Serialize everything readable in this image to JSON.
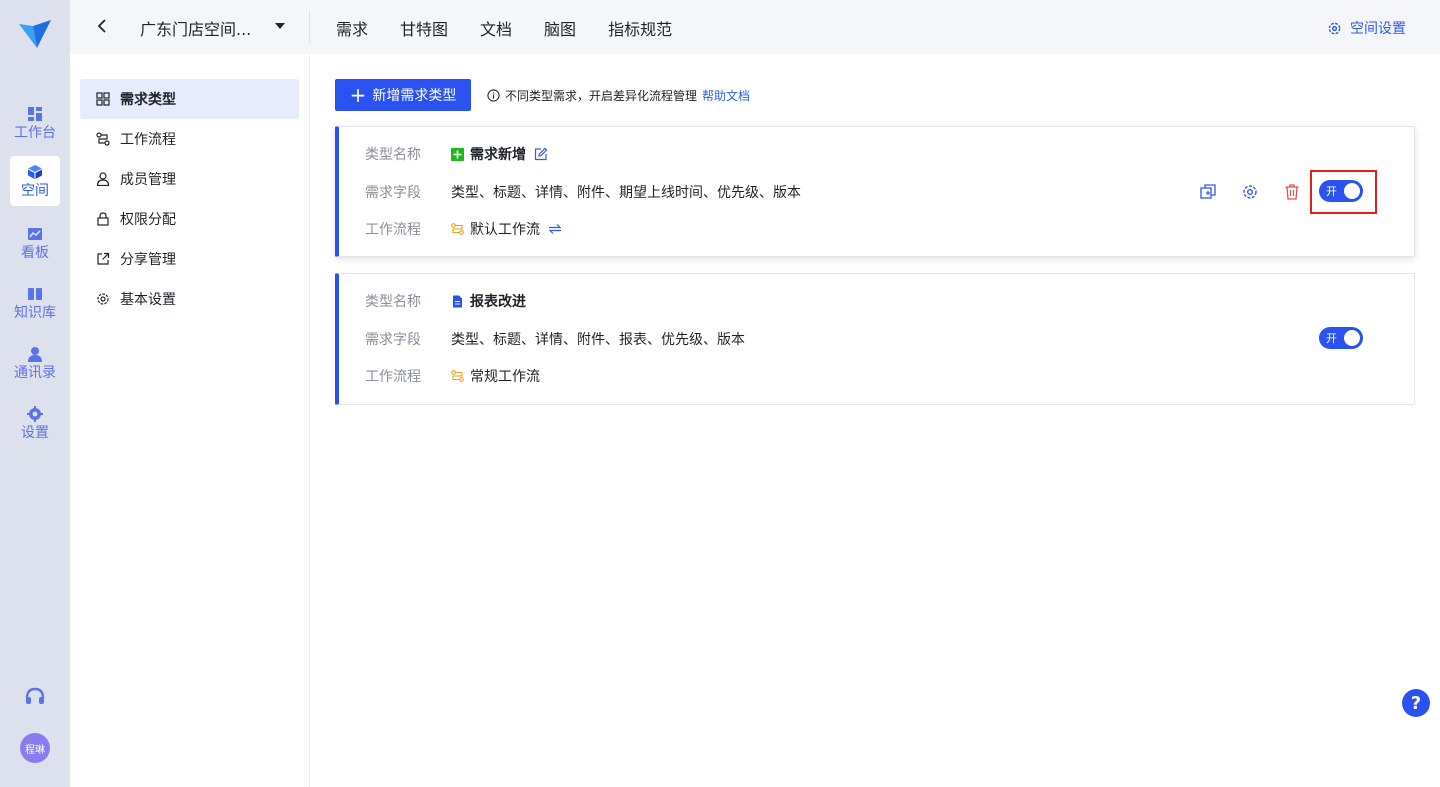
{
  "nav": {
    "items": [
      {
        "label": "工作台",
        "icon": "dashboard-icon"
      },
      {
        "label": "空间",
        "icon": "cube-icon",
        "active": true
      },
      {
        "label": "看板",
        "icon": "chart-icon"
      },
      {
        "label": "知识库",
        "icon": "book-icon"
      },
      {
        "label": "通讯录",
        "icon": "contacts-icon"
      },
      {
        "label": "设置",
        "icon": "gear-icon"
      }
    ],
    "avatar": "程琳"
  },
  "topbar": {
    "space_name": "广东门店空间...",
    "tabs": [
      "需求",
      "甘特图",
      "文档",
      "脑图",
      "指标规范"
    ],
    "settings_label": "空间设置"
  },
  "sidebar": {
    "items": [
      {
        "label": "需求类型",
        "icon": "grid-icon",
        "active": true
      },
      {
        "label": "工作流程",
        "icon": "workflow-icon"
      },
      {
        "label": "成员管理",
        "icon": "user-icon"
      },
      {
        "label": "权限分配",
        "icon": "lock-icon"
      },
      {
        "label": "分享管理",
        "icon": "share-icon"
      },
      {
        "label": "基本设置",
        "icon": "gear-icon"
      }
    ]
  },
  "main": {
    "add_button": "新增需求类型",
    "hint": "不同类型需求，开启差异化流程管理",
    "help_link": "帮助文档",
    "labels": {
      "type_name": "类型名称",
      "fields": "需求字段",
      "workflow": "工作流程"
    },
    "cards": [
      {
        "name": "需求新增",
        "icon": "plus-square-icon",
        "icon_color": "#1cb91c",
        "fields": "类型、标题、详情、附件、期望上线时间、优先级、版本",
        "workflow": "默认工作流",
        "toggle": "开",
        "enabled": true
      },
      {
        "name": "报表改进",
        "icon": "document-icon",
        "icon_color": "#2a52f0",
        "fields": "类型、标题、详情、附件、报表、优先级、版本",
        "workflow": "常规工作流",
        "toggle": "开",
        "enabled": true
      }
    ]
  },
  "help_fab": "?",
  "colors": {
    "accent": "#2a52f0",
    "danger": "#e34d4d",
    "highlight": "#e02020"
  }
}
